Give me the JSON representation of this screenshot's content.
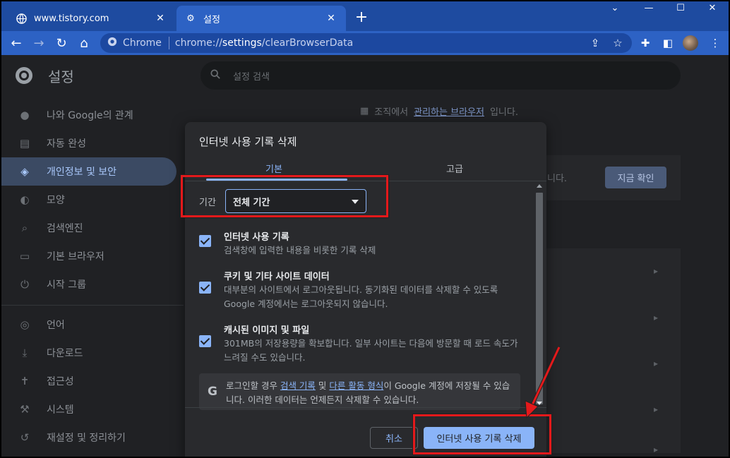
{
  "browser": {
    "tabs": [
      {
        "title": "www.tistory.com",
        "icon": "globe-icon",
        "active": false
      },
      {
        "title": "설정",
        "icon": "gear-icon",
        "active": true
      }
    ],
    "omnibox": {
      "chip_label": "Chrome",
      "url_scheme": "chrome://",
      "url_host": "settings",
      "url_path": "/clearBrowserData"
    }
  },
  "settings": {
    "title": "설정",
    "search_placeholder": "설정 검색",
    "sidebar": [
      {
        "label": "나와 Google의 관계",
        "icon": "person-icon"
      },
      {
        "label": "자동 완성",
        "icon": "clipboard-icon"
      },
      {
        "label": "개인정보 및 보안",
        "icon": "shield-icon",
        "active": true
      },
      {
        "label": "모양",
        "icon": "palette-icon"
      },
      {
        "label": "검색엔진",
        "icon": "search-icon"
      },
      {
        "label": "기본 브라우저",
        "icon": "browser-icon"
      },
      {
        "label": "시작 그룹",
        "icon": "power-icon"
      },
      {
        "label": "언어",
        "icon": "globe-icon"
      },
      {
        "label": "다운로드",
        "icon": "download-icon"
      },
      {
        "label": "접근성",
        "icon": "accessibility-icon"
      },
      {
        "label": "시스템",
        "icon": "wrench-icon"
      },
      {
        "label": "재설정 및 정리하기",
        "icon": "history-icon"
      }
    ],
    "managed": {
      "prefix": "조직에서 ",
      "link": "관리하는 브라우저",
      "suffix": "입니다."
    },
    "card_text": "니다.",
    "check_now": "지금 확인"
  },
  "dialog": {
    "title": "인터넷 사용 기록 삭제",
    "tabs": {
      "basic": "기본",
      "advanced": "고급"
    },
    "period_label": "기간",
    "period_value": "전체 기간",
    "options": [
      {
        "title": "인터넷 사용 기록",
        "desc": "검색창에 입력한 내용을 비롯한 기록 삭제",
        "checked": true
      },
      {
        "title": "쿠키 및 기타 사이트 데이터",
        "desc": "대부분의 사이트에서 로그아웃됩니다. 동기화된 데이터를 삭제할 수 있도록 Google 계정에서는 로그아웃되지 않습니다.",
        "checked": true
      },
      {
        "title": "캐시된 이미지 및 파일",
        "desc": "301MB의 저장용량을 확보합니다. 일부 사이트는 다음에 방문할 때 로드 속도가 느려질 수도 있습니다.",
        "checked": true
      }
    ],
    "info": {
      "part1": "로그인할 경우 ",
      "link1": "검색 기록",
      "part2": " 및 ",
      "link2": "다른 활동 형식",
      "part3": "이 Google 계정에 저장될 수 있습니다. 이러한 데이터는 언제든지 삭제할 수 있습니다."
    },
    "cancel": "취소",
    "confirm": "인터넷 사용 기록 삭제"
  },
  "colors": {
    "annotation": "#e3191b",
    "accent": "#8ab4f8",
    "titlebar": "#1e4ba0"
  }
}
